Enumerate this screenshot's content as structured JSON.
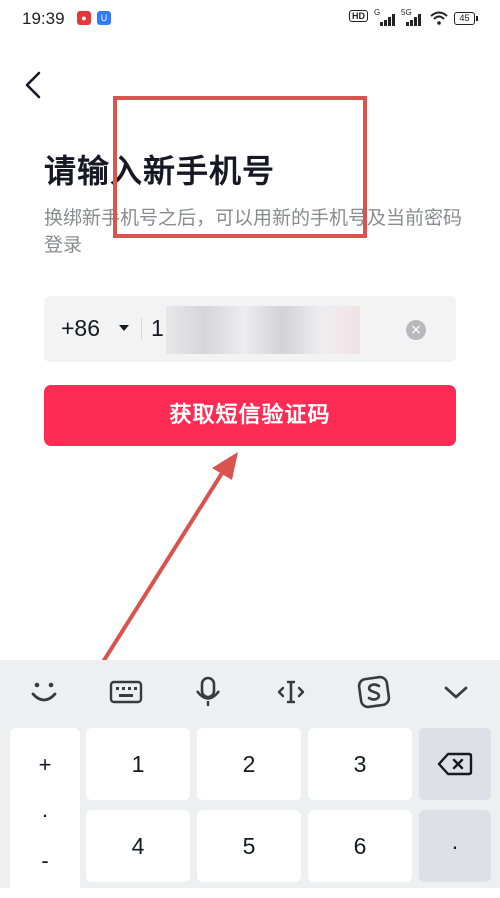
{
  "status_bar": {
    "time": "19:39",
    "signal_labels": [
      "G",
      "5G"
    ],
    "battery": "45",
    "hd_label": "HD"
  },
  "page": {
    "title": "请输入新手机号",
    "subtitle": "换绑新手机号之后，可以用新的手机号及当前密码登录",
    "country_code": "+86",
    "phone_number": "1",
    "cta_label": "获取短信验证码"
  },
  "keyboard": {
    "side_keys": [
      "+",
      "·",
      "-"
    ],
    "digits": [
      "1",
      "2",
      "3",
      "4",
      "5",
      "6"
    ],
    "dot_key": "·",
    "toolbar": [
      "emoji-icon",
      "keyboard-icon",
      "microphone-icon",
      "text-cursor-icon",
      "sogou-icon",
      "collapse-icon"
    ]
  },
  "colors": {
    "accent": "#fe2c55",
    "annotation": "#d9534f",
    "text": "#161823",
    "subtext": "#8a8b91"
  }
}
